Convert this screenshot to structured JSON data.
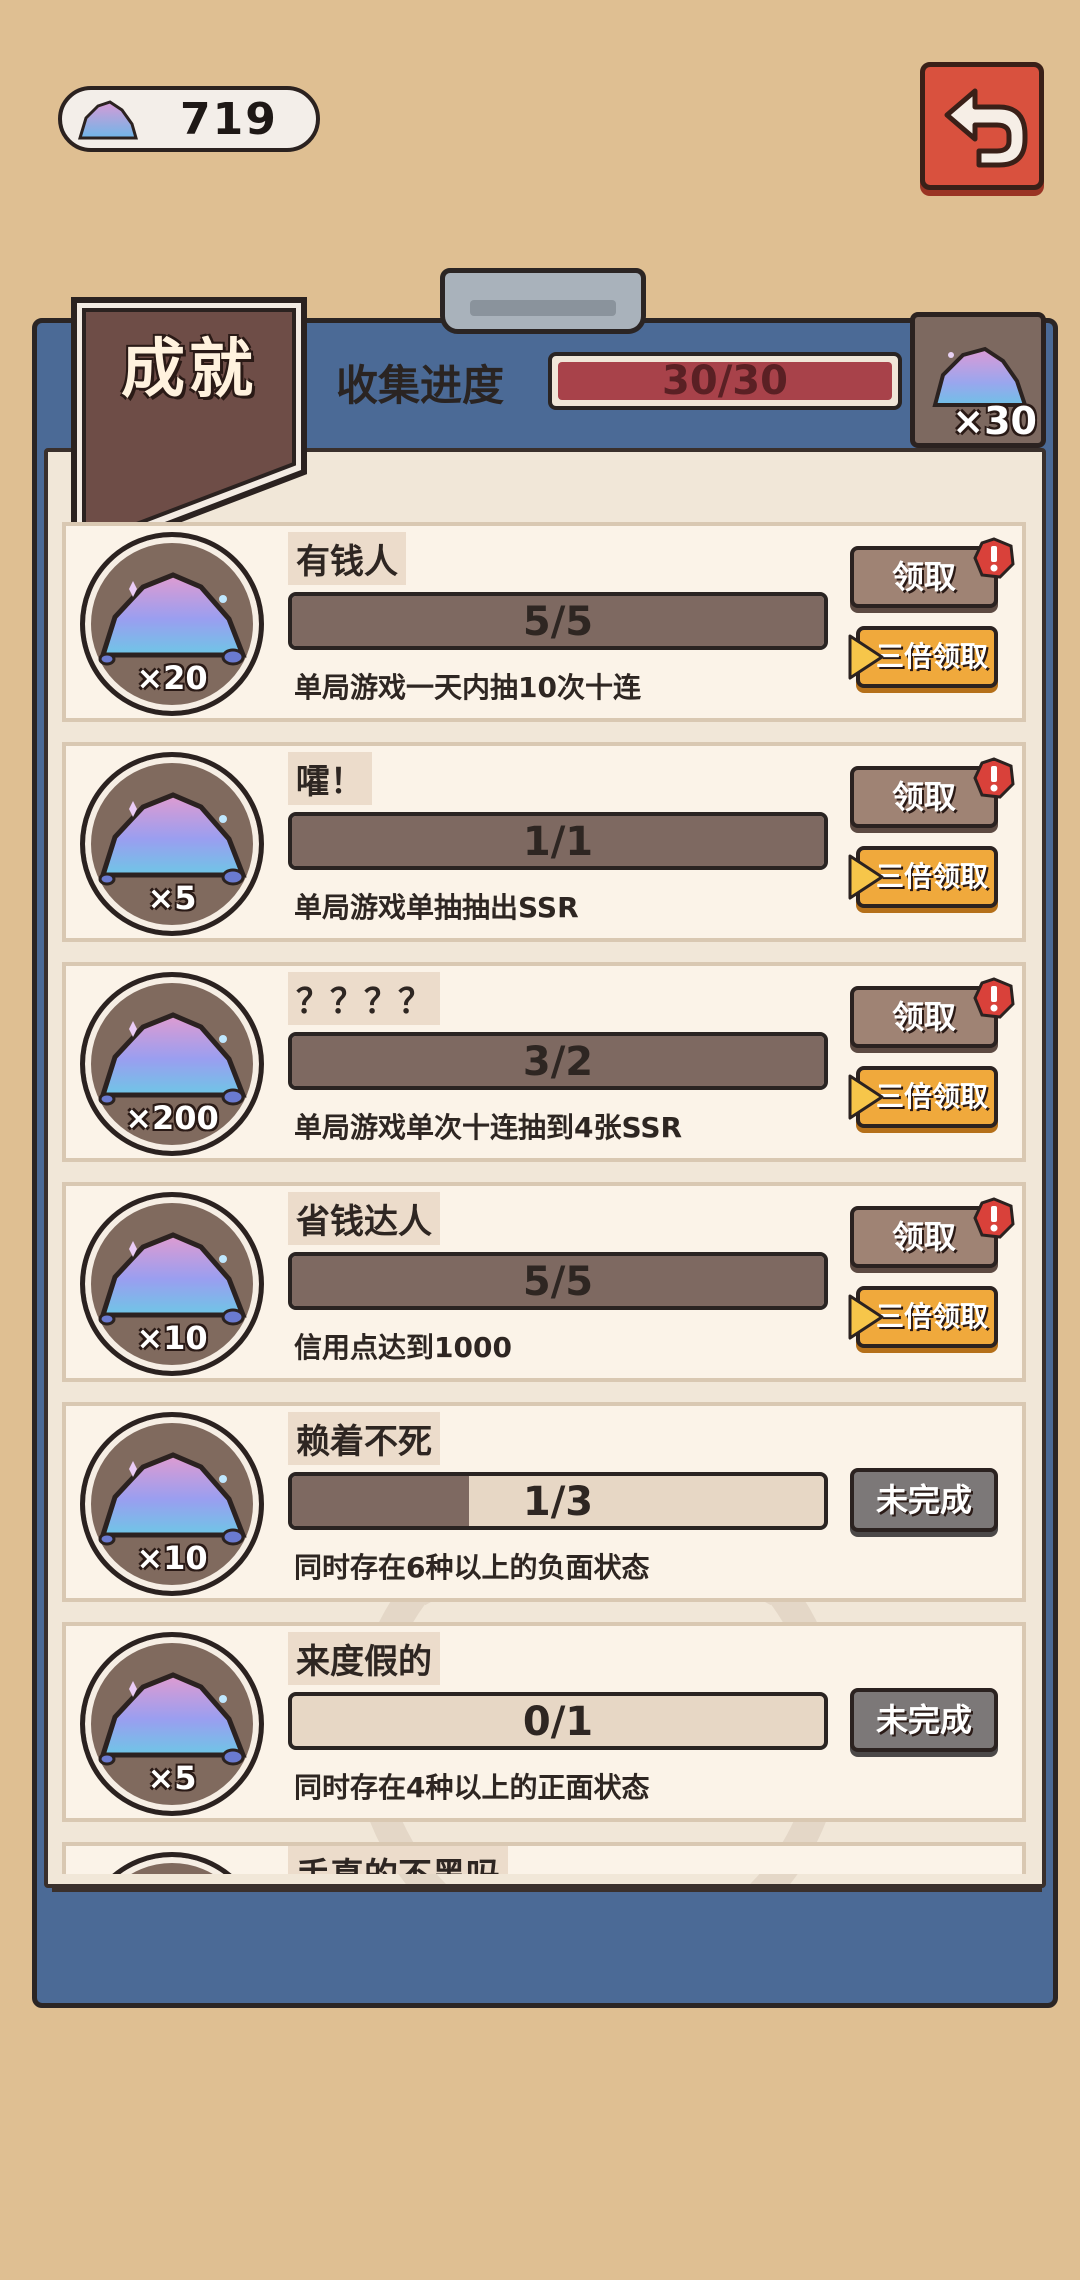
{
  "header": {
    "currency_amount": "719",
    "title": "成就",
    "collect_label": "收集进度",
    "collect_progress_text": "30/30",
    "collect_progress_fraction": 1.0,
    "reward_qty": "×30"
  },
  "achievements": [
    {
      "name": "有钱人",
      "progress_text": "5/5",
      "progress_fraction": 1.0,
      "desc": "单局游戏一天内抽10次十连",
      "reward": "×20",
      "status": "claimable"
    },
    {
      "name": "嚯！",
      "progress_text": "1/1",
      "progress_fraction": 1.0,
      "desc": "单局游戏单抽抽出SSR",
      "reward": "×5",
      "status": "claimable"
    },
    {
      "name": "？？？？",
      "progress_text": "3/2",
      "progress_fraction": 1.0,
      "desc": "单局游戏单次十连抽到4张SSR",
      "reward": "×200",
      "status": "claimable"
    },
    {
      "name": "省钱达人",
      "progress_text": "5/5",
      "progress_fraction": 1.0,
      "desc": "信用点达到1000",
      "reward": "×10",
      "status": "claimable"
    },
    {
      "name": "赖着不死",
      "progress_text": "1/3",
      "progress_fraction": 0.333,
      "desc": "同时存在6种以上的负面状态",
      "reward": "×10",
      "status": "incomplete"
    },
    {
      "name": "来度假的",
      "progress_text": "0/1",
      "progress_fraction": 0.0,
      "desc": "同时存在4种以上的正面状态",
      "reward": "×5",
      "status": "incomplete"
    },
    {
      "name": "手真的不黑吗",
      "progress_text": "",
      "progress_fraction": 0.0,
      "desc": "",
      "reward": "",
      "status": "partial"
    }
  ],
  "buttons": {
    "claim": "领取",
    "triple_claim": "三倍领取",
    "incomplete": "未完成"
  },
  "colors": {
    "background": "#dfbf92",
    "board": "#4b6a96",
    "paper": "#f1e7d8",
    "progress_fill": "#7e6961",
    "collect_fill": "#a8424a",
    "triple_button": "#f0a93c",
    "back_button": "#d9513e"
  },
  "icons": [
    "crystal-icon",
    "back-arrow-icon",
    "alert-icon",
    "play-arrow-icon"
  ]
}
